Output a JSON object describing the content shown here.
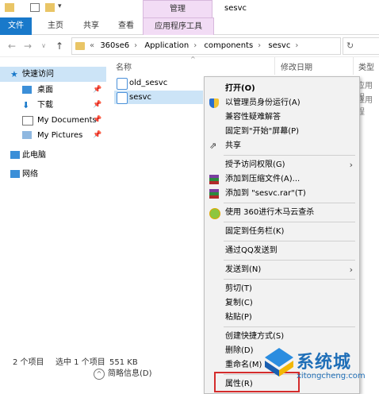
{
  "titlebar": {
    "context_tab": "管理",
    "window_title": "sesvc"
  },
  "ribbon": {
    "tabs": [
      "文件",
      "主页",
      "共享",
      "查看",
      "应用程序工具"
    ]
  },
  "address": {
    "more": "«",
    "crumbs": [
      "360se6",
      "Application",
      "components",
      "sesvc"
    ]
  },
  "nav": {
    "quick_access": "快速访问",
    "items": [
      "桌面",
      "下载",
      "My Documents",
      "My Pictures"
    ],
    "this_pc": "此电脑",
    "network": "网络"
  },
  "columns": {
    "name": "名称",
    "modified": "修改日期",
    "type": "类型"
  },
  "files": [
    {
      "name": "old_sesvc",
      "type": "应用程"
    },
    {
      "name": "sesvc",
      "type": "应用程"
    }
  ],
  "status": {
    "count": "2 个项目",
    "selected": "选中 1 个项目",
    "size": "551 KB"
  },
  "hints": {
    "label": "简略信息(D)"
  },
  "context_menu": {
    "open": "打开(O)",
    "run_as_admin": "以管理员身份运行(A)",
    "troubleshoot": "兼容性疑难解答",
    "pin_start": "固定到\"开始\"屏幕(P)",
    "share": "共享",
    "grant_access": "授予访问权限(G)",
    "add_archive": "添加到压缩文件(A)...",
    "add_rar": "添加到 \"sesvc.rar\"(T)",
    "scan_360": "使用 360进行木马云查杀",
    "pin_taskbar": "固定到任务栏(K)",
    "send_qq": "通过QQ发送到",
    "send_to": "发送到(N)",
    "cut": "剪切(T)",
    "copy": "复制(C)",
    "paste": "粘贴(P)",
    "create_shortcut": "创建快捷方式(S)",
    "delete": "删除(D)",
    "rename": "重命名(M)",
    "properties": "属性(R)"
  },
  "watermark": {
    "brand": "系统城",
    "url": "xitongcheng.com"
  },
  "colors": {
    "accent": "#1979ca",
    "context_tab_bg": "#f2dcf5",
    "selection": "#cce4f7",
    "highlight_box": "#d42c2c"
  }
}
